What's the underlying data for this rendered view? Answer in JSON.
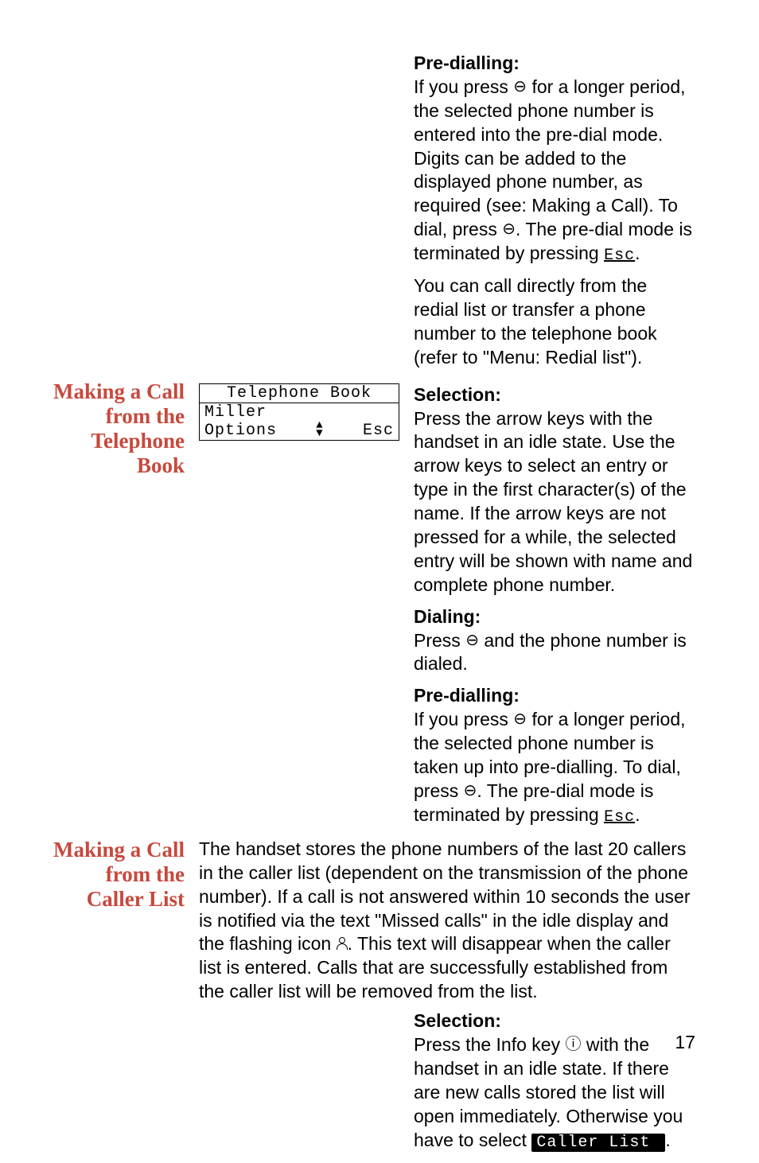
{
  "section_top": {
    "predialling_h": "Pre-dialling:",
    "predial_p1a": "If you press ",
    "predial_p1b": " for a longer period, the selected phone number is entered into the pre-dial mode. Digits can be added to the displayed phone number, as required (see: Making a Call). To dial, press ",
    "predial_p1c": ". The pre-dial mode is terminated by pressing ",
    "esc": "Esc",
    "predial_p1d": ".",
    "p2": "You can call directly from the redial list or transfer a phone number to the telephone book (refer to \"Menu: Redial list\")."
  },
  "section_phonebook": {
    "side_heading": "Making a Call from the Telephone Book",
    "lcd": {
      "title": "Telephone Book",
      "entry": "Miller",
      "soft_left": "Options",
      "soft_right": "Esc"
    },
    "selection_h": "Selection:",
    "selection_p": "Press the arrow keys with the handset in an idle state. Use the arrow keys to select an entry or type in the first character(s) of the name. If the arrow keys are not pressed for a while, the selected entry will be shown with name and complete phone number.",
    "dialing_h": "Dialing:",
    "dial_p_a": "Press ",
    "dial_p_b": " and the phone number is dialed.",
    "predial_h": "Pre-dialling:",
    "pre_p_a": "If you press ",
    "pre_p_b": " for a longer period, the selected phone number is taken up into pre-dialling. To dial, press ",
    "pre_p_c": ". The pre-dial mode is terminated by pressing ",
    "esc": "Esc",
    "pre_p_d": "."
  },
  "section_callerlist": {
    "side_heading": "Making a Call from the Caller List",
    "intro_a": "The handset stores the phone numbers of the last 20 callers in the caller list (dependent on the transmission of the phone number). If a call is not answered within 10 seconds the user is notified via the text \"Missed calls\" in the idle display and the flashing icon ",
    "intro_b": ". This text will disappear when the caller list is entered. Calls that are successfully established from the caller list will be removed from the list.",
    "selection_h": "Selection:",
    "sel_p_a": "Press the Info key ",
    "sel_p_b": " with the handset in an idle state. If there are new calls stored the list will open immediately. Otherwise you have to select ",
    "caller_list_btn": " Caller List ",
    "sel_p_c": "."
  },
  "glyphs": {
    "hook": "⊖",
    "info": "ⓘ"
  },
  "page_number": "17"
}
